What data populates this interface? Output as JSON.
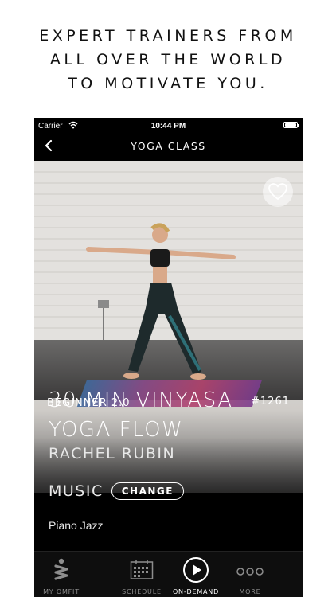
{
  "headline": {
    "line1": "EXPERT TRAINERS FROM",
    "line2": "ALL OVER THE WORLD",
    "line3": "TO MOTIVATE YOU."
  },
  "status_bar": {
    "carrier": "Carrier",
    "time": "10:44 PM"
  },
  "nav": {
    "title": "YOGA CLASS"
  },
  "class": {
    "level": "BEGINNER 2.0",
    "id": "#1261",
    "title_line1": "30 MIN VINYASA",
    "title_line2": "YOGA FLOW",
    "trainer": "RACHEL RUBIN",
    "music_label": "MUSIC",
    "change_label": "CHANGE",
    "music_value": "Piano Jazz"
  },
  "tabs": [
    {
      "label": "MY OMFIT",
      "icon": "omfit-logo-icon",
      "active": false
    },
    {
      "label": "SCHEDULE",
      "icon": "calendar-icon",
      "active": false
    },
    {
      "label": "ON-DEMAND",
      "icon": "play-icon",
      "active": true
    },
    {
      "label": "MORE",
      "icon": "more-dots-icon",
      "active": false
    }
  ],
  "colors": {
    "background": "#000000",
    "text": "#ffffff",
    "inactive_tab": "#8d8d8d"
  }
}
